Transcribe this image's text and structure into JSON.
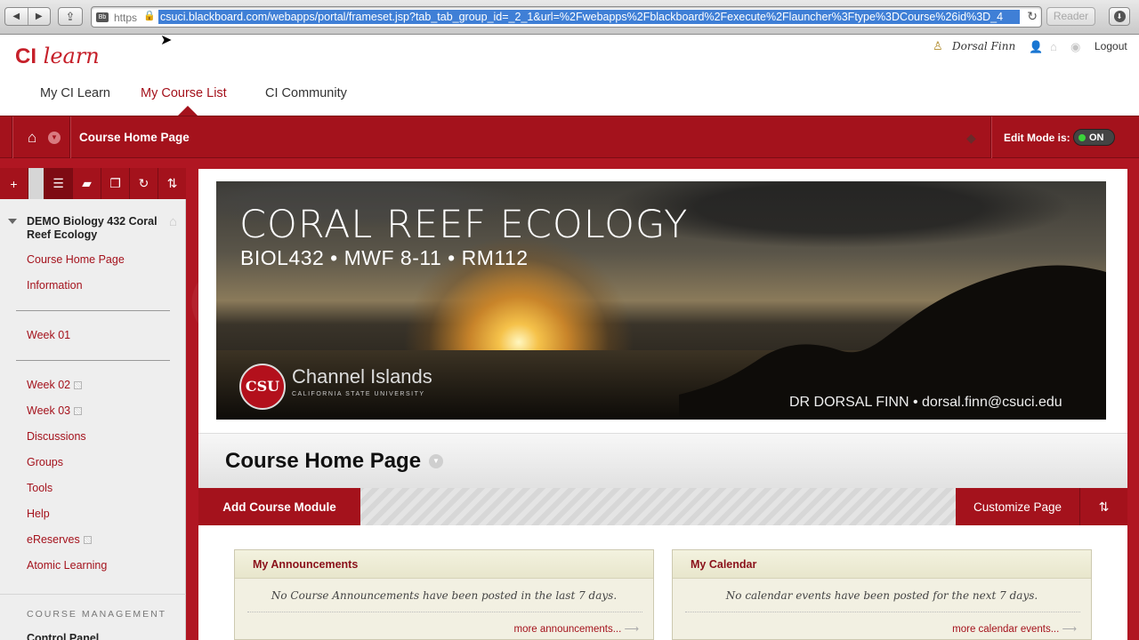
{
  "browser": {
    "protocol": "https",
    "url": "csuci.blackboard.com/webapps/portal/frameset.jsp?tab_tab_group_id=_2_1&url=%2Fwebapps%2Fblackboard%2Fexecute%2Flauncher%3Ftype%3DCourse%26id%3D_4",
    "reader_label": "Reader"
  },
  "site": {
    "logo_bold": "CI",
    "logo_italic": "learn",
    "user_name": "Dorsal Finn",
    "logout_label": "Logout",
    "tabs": [
      {
        "label": "My CI Learn"
      },
      {
        "label": "My Course List"
      },
      {
        "label": "CI Community"
      }
    ]
  },
  "course_bar": {
    "title": "Course Home Page",
    "edit_mode_label": "Edit Mode is:",
    "edit_mode_value": "ON"
  },
  "sidebar": {
    "course_title": "DEMO Biology 432 Coral Reef Ecology",
    "items": [
      {
        "label": "Course Home Page"
      },
      {
        "label": "Information"
      },
      {
        "label": "Week 01"
      },
      {
        "label": "Week 02"
      },
      {
        "label": "Week 03"
      },
      {
        "label": "Discussions"
      },
      {
        "label": "Groups"
      },
      {
        "label": "Tools"
      },
      {
        "label": "Help"
      },
      {
        "label": "eReserves"
      },
      {
        "label": "Atomic Learning"
      }
    ],
    "management_header": "COURSE MANAGEMENT",
    "control_panel": "Control Panel"
  },
  "banner": {
    "title": "CORAL REEF ECOLOGY",
    "subtitle": "BIOL432 • MWF 8-11 • RM112",
    "seal": "CSU",
    "campus": "Channel Islands",
    "university": "CALIFORNIA STATE UNIVERSITY",
    "instructor": "DR DORSAL FINN • dorsal.finn@csuci.edu"
  },
  "main": {
    "page_title": "Course Home Page",
    "add_module_label": "Add Course Module",
    "customize_label": "Customize Page",
    "modules": [
      {
        "title": "My Announcements",
        "message": "No Course Announcements have been posted in the last 7 days.",
        "more": "more announcements..."
      },
      {
        "title": "My Calendar",
        "message": "No calendar events have been posted for the next 7 days.",
        "more": "more calendar events..."
      }
    ]
  },
  "colors": {
    "brand_red": "#a4121c",
    "toggle_on": "#3bd43b"
  }
}
